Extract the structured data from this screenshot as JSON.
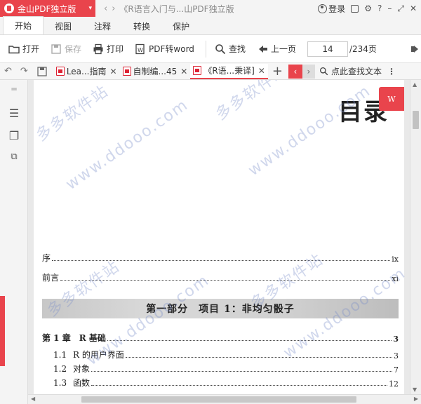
{
  "titlebar": {
    "app_name": "金山PDF独立版",
    "back_glyph": "‹",
    "forward_glyph": "›",
    "document_title": "《R语言入门与...山PDF独立版",
    "login_label": "登录",
    "help_glyph": "?",
    "min_glyph": "–",
    "restore_glyph": "⤢",
    "close_glyph": "✕"
  },
  "menu": {
    "tabs": [
      "开始",
      "视图",
      "注释",
      "转换",
      "保护"
    ]
  },
  "toolbar": {
    "open": "打开",
    "save": "保存",
    "print": "打印",
    "to_word": "PDF转word",
    "find": "查找",
    "prev_page": "上一页",
    "current_page": "14",
    "total_pages": "/234页"
  },
  "tabs": {
    "items": [
      {
        "label": "Lea...指南",
        "close": "✕"
      },
      {
        "label": "自制编...45",
        "close": "✕"
      },
      {
        "label": "《R语...秉译]",
        "close": "✕"
      }
    ],
    "add": "+",
    "prev": "‹",
    "next": "›",
    "find_text": "点此查找文本",
    "more": "⋮"
  },
  "document": {
    "title": "目录",
    "convert_badge": "W",
    "toc": [
      {
        "label": "序",
        "page": "ix"
      },
      {
        "label": "前言",
        "page": "xi"
      }
    ],
    "part_banner": "第一部分　项目 1：非均匀骰子",
    "chapter": {
      "label": "第 1 章　R 基础",
      "page": "3"
    },
    "sections": [
      {
        "num": "1.1",
        "label": "R 的用户界面",
        "page": "3"
      },
      {
        "num": "1.2",
        "label": "对象",
        "page": "7"
      },
      {
        "num": "1.3",
        "label": "函数",
        "page": "12"
      }
    ],
    "watermarks": [
      "多多软件站",
      "www.ddooo.com"
    ]
  },
  "colors": {
    "accent": "#e9444c"
  }
}
